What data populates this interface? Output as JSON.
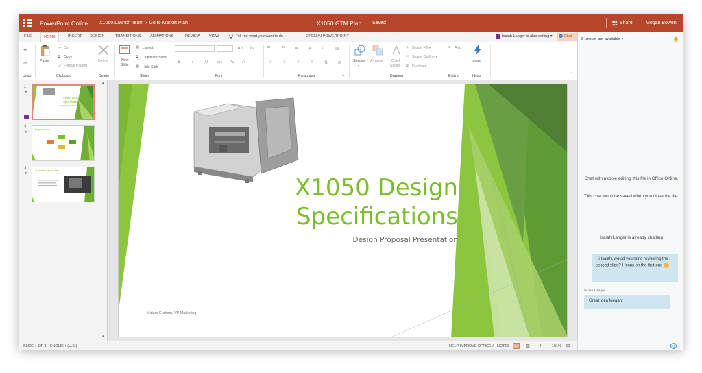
{
  "titlebar": {
    "app_name": "PowerPoint Online",
    "breadcrumb_team": "X1050 Launch Team",
    "breadcrumb_sep": "›",
    "breadcrumb_file": "Go to Market Plan",
    "doc_title": "X1050 GTM Plan",
    "dash": "-",
    "save_state": "Saved",
    "share_label": "Share",
    "user_name": "Megan Bowen"
  },
  "tabs": {
    "file": "FILE",
    "home": "HOME",
    "insert": "INSERT",
    "design": "DESIGN",
    "transitions": "TRANSITIONS",
    "animations": "ANIMATIONS",
    "review": "REVIEW",
    "view": "VIEW",
    "tell_me": "Tell me what you want to do",
    "open_in": "OPEN IN POWERPOINT",
    "editing_notice": "Isaiah Langer is also editing ▾",
    "chat": "Chat"
  },
  "ribbon": {
    "undo_group": "Undo",
    "paste": "Paste",
    "cut": "Cut",
    "copy": "Copy",
    "format_painter": "Format Painter",
    "clipboard_group": "Clipboard",
    "delete": "Delete",
    "delete_group": "Delete",
    "new_slide_1": "New",
    "new_slide_2": "Slide",
    "layout": "Layout",
    "duplicate_slide": "Duplicate Slide",
    "hide_slide": "Hide Slide",
    "slides_group": "Slides",
    "bold": "B",
    "italic": "I",
    "underline": "U",
    "strike": "abc",
    "font_group": "Font",
    "paragraph_group": "Paragraph",
    "shapes": "Shapes",
    "arrange": "Arrange",
    "quick_styles_1": "Quick",
    "quick_styles_2": "Styles",
    "shape_fill": "Shape Fill ▾",
    "shape_outline": "Shape Outline ▾",
    "duplicate": "Duplicate",
    "drawing_group": "Drawing",
    "find": "Find",
    "editing_group": "Editing",
    "ideas": "Ideas",
    "ideas_group": "Ideas",
    "collapse": "⌃"
  },
  "thumbnails": [
    {
      "num": "1",
      "mark": "★",
      "title": "X1050 Design Specifications",
      "sub": "Design Proposal Presentation"
    },
    {
      "num": "2",
      "mark": "★",
      "title": "Project scope"
    },
    {
      "num": "3",
      "mark": "★",
      "title": "Customer: Launch Plan"
    }
  ],
  "slide": {
    "title": "X1050 Design Specifications",
    "subtitle": "Design Proposal Presentation",
    "author": "Miriam Graham, VP Marketing"
  },
  "statusbar": {
    "slide_count": "SLIDE 1 OF 3",
    "language": "ENGLISH (U.S.)",
    "help": "HELP IMPROVE OFFICE",
    "notes": "NOTES",
    "zoom": "101%"
  },
  "chat": {
    "available": "2 people are available ▾",
    "info_1": "Chat with people editing this file in Office Online.",
    "info_2": "This chat won't be saved when you close the file.",
    "already": "Isaiah Langer is already chatting",
    "message_1": "Hi Isaiah, would you mind reviewing the second slide? I focus on the first one",
    "sender_2": "Isaiah Langer",
    "message_2": "Great idea Megan!"
  },
  "colors": {
    "accent": "#b7472a",
    "slide_green": "#79bd28",
    "chat_bubble": "#cfe6f1"
  }
}
